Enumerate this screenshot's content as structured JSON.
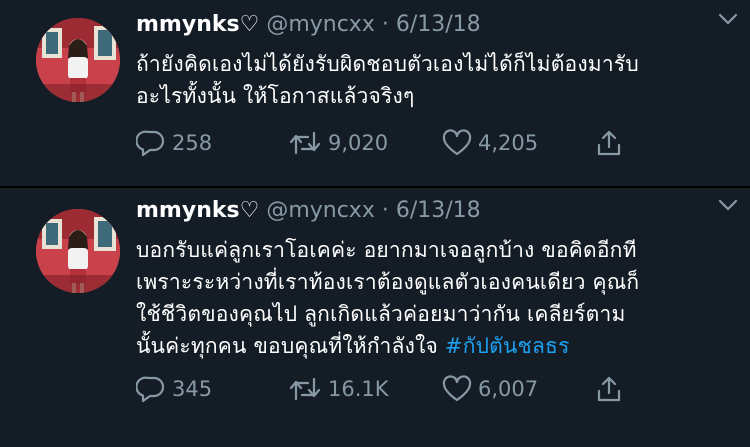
{
  "colors": {
    "background": "#141d26",
    "text": "#ffffff",
    "secondary": "#8899a6",
    "link": "#1da1f2",
    "divider": "#000000"
  },
  "tweets": [
    {
      "display_name": "mmynks♡",
      "handle": "@myncxx",
      "separator": "·",
      "date": "6/13/18",
      "text": "ถ้ายังคิดเองไม่ได้ยังรับผิดชอบตัวเองไม่ได้ก็ไม่ต้องมารับ\nอะไรทั้งนั้น ให้โอกาสแล้วจริงๆ",
      "replies": "258",
      "retweets": "9,020",
      "likes": "4,205",
      "icons": [
        "reply-icon",
        "retweet-icon",
        "like-icon",
        "share-icon",
        "caret-down-icon"
      ]
    },
    {
      "display_name": "mmynks♡",
      "handle": "@myncxx",
      "separator": "·",
      "date": "6/13/18",
      "text": "บอกรับแค่ลูกเราโอเคค่ะ อยากมาเจอลูกบ้าง ขอคิดอีกที\nเพราะระหว่างที่เราท้องเราต้องดูแลตัวเองคนเดียว คุณก็\nใช้ชีวิตของคุณไป ลูกเกิดแล้วค่อยมาว่ากัน เคลียร์ตาม\nนั้นค่ะทุกคน ขอบคุณที่ให้กำลังใจ ",
      "hashtag": "#กัปตันชลธร",
      "replies": "345",
      "retweets": "16.1K",
      "likes": "6,007",
      "icons": [
        "reply-icon",
        "retweet-icon",
        "like-icon",
        "share-icon",
        "caret-down-icon"
      ]
    }
  ]
}
